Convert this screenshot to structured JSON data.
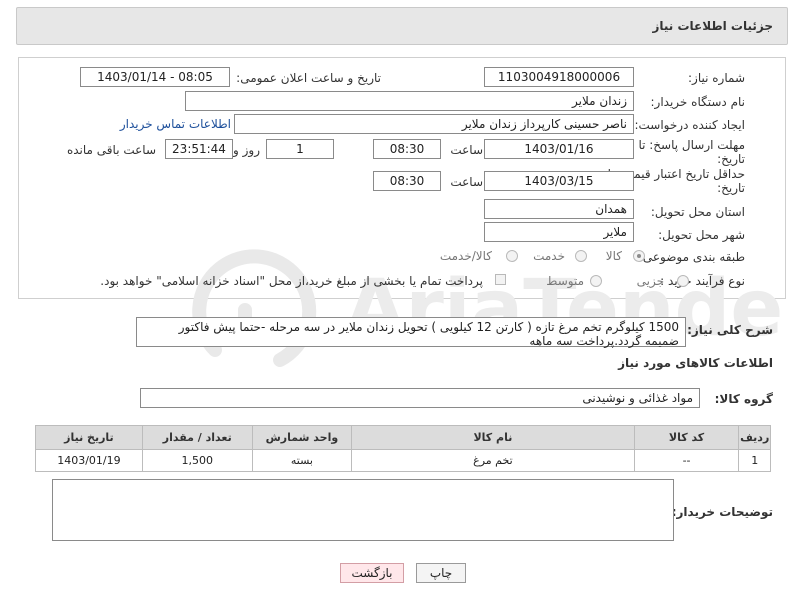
{
  "header": {
    "title": "جزئیات اطلاعات نیاز"
  },
  "form": {
    "need_number_label": "شماره نیاز:",
    "need_number": "1103004918000006",
    "announce_label": "تاریخ و ساعت اعلان عمومی:",
    "announce_value": "1403/01/14 - 08:05",
    "buyer_org_label": "نام دستگاه خریدار:",
    "buyer_org": "زندان ملایر",
    "creator_label": "ایجاد کننده درخواست:",
    "creator": "ناصر  حسینی کارپرداز زندان ملایر",
    "contact_link": "اطلاعات تماس خریدار",
    "deadline_label_1": "مهلت ارسال پاسخ: تا",
    "deadline_label_2": "تاریخ:",
    "deadline_date": "1403/01/16",
    "time_label": "ساعت",
    "deadline_time": "08:30",
    "days_value": "1",
    "days_label": "روز و",
    "remaining_time": "23:51:44",
    "remaining_label": "ساعت باقی مانده",
    "price_label_1": "حداقل تاریخ اعتبار قیمت: تا",
    "price_label_2": "تاریخ:",
    "price_date": "1403/03/15",
    "price_time": "08:30",
    "province_label": "استان محل تحویل:",
    "province": "همدان",
    "city_label": "شهر محل تحویل:",
    "city": "ملایر",
    "category_label": "طبقه بندی موضوعی:",
    "category_options": [
      "کالا",
      "خدمت",
      "کالا/خدمت"
    ],
    "process_label": "نوع فرآیند خرید :",
    "process_options": [
      "جزیی",
      "متوسط"
    ],
    "payment_note": "پرداخت تمام یا بخشی از مبلغ خرید،از محل \"اسناد خزانه اسلامی\" خواهد بود."
  },
  "description": {
    "label": "شرح کلی نیاز:",
    "text": "1500 کیلوگرم تخم مرغ تازه ( کارتن 12 کیلویی ) تحویل زندان ملایر در سه مرحله -حتما پیش فاکتور ضمیمه گردد.پرداخت سه ماهه"
  },
  "goods": {
    "section_title": "اطلاعات کالاهای مورد نیاز",
    "group_label": "گروه کالا:",
    "group_value": "مواد غذائی و نوشیدنی",
    "columns": [
      "ردیف",
      "کد کالا",
      "نام کالا",
      "واحد شمارش",
      "تعداد / مقدار",
      "تاریخ نیاز"
    ],
    "rows": [
      [
        "1",
        "--",
        "تخم مرغ",
        "بسته",
        "1,500",
        "1403/01/19"
      ]
    ]
  },
  "buyer_notes": {
    "label": "توضیحات خریدار:",
    "value": ""
  },
  "buttons": {
    "print": "چاپ",
    "back": "بازگشت"
  },
  "watermark": {
    "text": "AriaTender.neT"
  }
}
